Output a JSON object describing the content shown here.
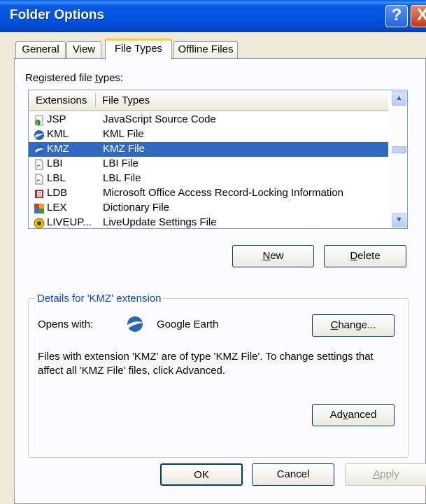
{
  "window": {
    "title": "Folder Options",
    "help_label": "?",
    "close_label": "X"
  },
  "tabs": [
    {
      "label": "General"
    },
    {
      "label": "View"
    },
    {
      "label": "File Types",
      "active": true
    },
    {
      "label": "Offline Files"
    }
  ],
  "registered": {
    "label_before": "Registered file ",
    "label_underlined": "t",
    "label_after": "ypes:"
  },
  "list": {
    "columns": [
      "Extensions",
      "File Types"
    ],
    "rows": [
      {
        "ext": "JSP",
        "type": "JavaScript Source Code",
        "icon": "script-icon"
      },
      {
        "ext": "KML",
        "type": "KML File",
        "icon": "google-earth-icon"
      },
      {
        "ext": "KMZ",
        "type": "KMZ File",
        "icon": "google-earth-icon",
        "selected": true
      },
      {
        "ext": "LBI",
        "type": "LBI File",
        "icon": "generic-file-icon"
      },
      {
        "ext": "LBL",
        "type": "LBL File",
        "icon": "generic-file-icon"
      },
      {
        "ext": "LDB",
        "type": "Microsoft Office Access Record-Locking Information",
        "icon": "access-icon"
      },
      {
        "ext": "LEX",
        "type": "Dictionary File",
        "icon": "dictionary-icon"
      },
      {
        "ext": "LIVEUP...",
        "type": "LiveUpdate Settings File",
        "icon": "liveupdate-icon"
      }
    ]
  },
  "buttons": {
    "new_u": "N",
    "new_rest": "ew",
    "delete_u": "D",
    "delete_rest": "elete",
    "change_u": "C",
    "change_rest": "hange...",
    "advanced_pre": "Ad",
    "advanced_u": "v",
    "advanced_post": "anced",
    "ok": "OK",
    "cancel": "Cancel",
    "apply_u": "A",
    "apply_rest": "pply"
  },
  "details": {
    "legend": "Details for 'KMZ' extension",
    "opens_with_label": "Opens with:",
    "app_name": "Google Earth",
    "description": "Files with extension 'KMZ' are of type 'KMZ File'.  To change settings that affect all 'KMZ File' files, click Advanced."
  },
  "colors": {
    "selection": "#316AC5",
    "titlebar": "#0054E3",
    "group_legend": "#0046D5",
    "active_tab_highlight": "#FFC83C"
  }
}
